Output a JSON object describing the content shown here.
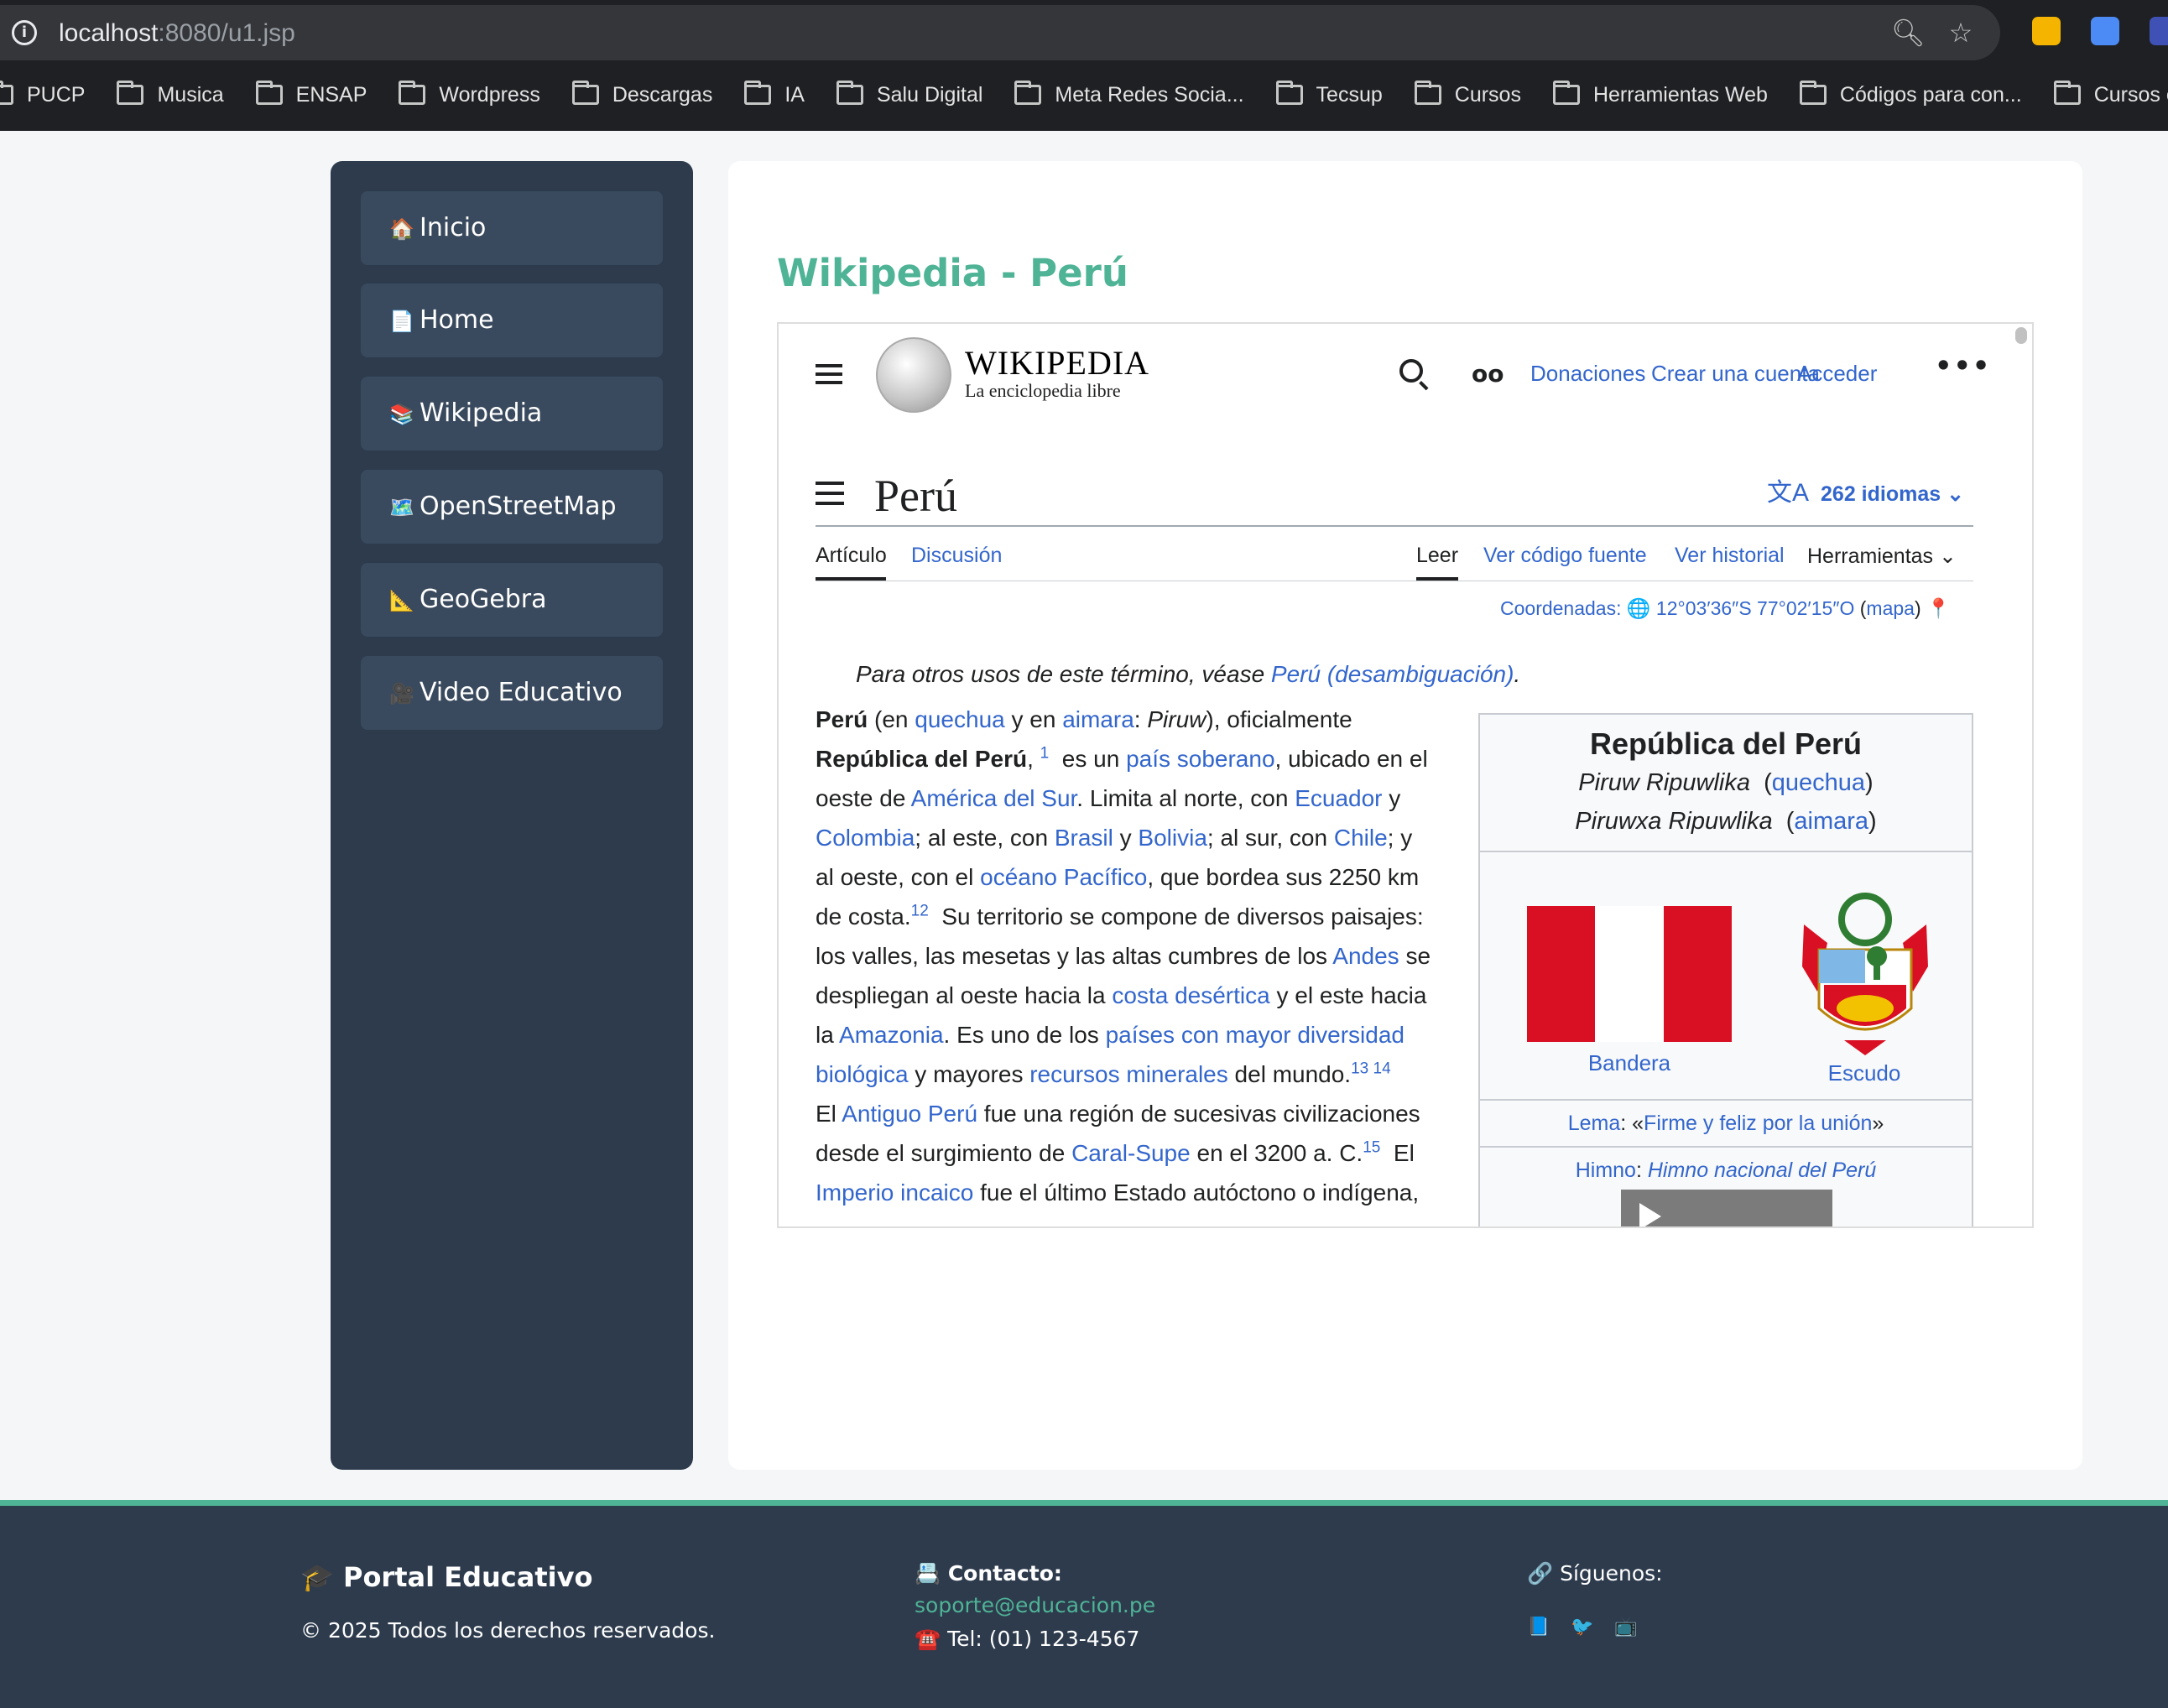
{
  "browser": {
    "url_host": "localhost",
    "url_path": ":8080/u1.jsp",
    "bookmarks": [
      "PUCP",
      "Musica",
      "ENSAP",
      "Wordpress",
      "Descargas",
      "IA",
      "Salu Digital",
      "Meta Redes Socia...",
      "Tecsup",
      "Cursos",
      "Herramientas Web",
      "Códigos para con...",
      "Cursos e"
    ]
  },
  "sidebar": {
    "items": [
      {
        "icon": "🏠",
        "label": "Inicio"
      },
      {
        "icon": "📄",
        "label": "Home"
      },
      {
        "icon": "📚",
        "label": "Wikipedia"
      },
      {
        "icon": "🗺️",
        "label": "OpenStreetMap"
      },
      {
        "icon": "📐",
        "label": "GeoGebra"
      },
      {
        "icon": "🎥",
        "label": "Video Educativo"
      }
    ]
  },
  "main": {
    "title": "Wikipedia - Perú"
  },
  "wiki": {
    "wordmark": "WIKIPEDIA",
    "tagline": "La enciclopedia libre",
    "header_links": [
      "Donaciones",
      "Crear una cuenta",
      "Acceder"
    ],
    "article_title": "Perú",
    "languages": "262 idiomas",
    "tabs_left": [
      "Artículo",
      "Discusión"
    ],
    "tabs_right": [
      "Leer",
      "Ver código fuente",
      "Ver historial",
      "Herramientas"
    ],
    "coords_label": "Coordenadas:",
    "coords_value": "12°03′36″S 77°02′15″O",
    "coords_map": "mapa",
    "hatnote_text": "Para otros usos de este término, véase ",
    "hatnote_link": "Perú (desambiguación)",
    "infobox": {
      "title": "República del Perú",
      "name_quechua": "Piruw Ripuwlika",
      "lang_quechua": "quechua",
      "name_aimara": "Piruwxa Ripuwlika",
      "lang_aimara": "aimara",
      "flag_caption": "Bandera",
      "coat_caption": "Escudo",
      "motto_label": "Lema",
      "motto": "Firme y feliz por la unión",
      "anthem_label": "Himno",
      "anthem": "Himno nacional del Perú"
    }
  },
  "footer": {
    "brand": "🎓 Portal Educativo",
    "copyright": "© 2025 Todos los derechos reservados.",
    "contact_title": "📇 Contacto:",
    "email": "soporte@educacion.pe",
    "phone": "☎️ Tel: (01) 123-4567",
    "follow": "🔗 Síguenos:",
    "social_icons": [
      "📘",
      "🐦",
      "📺"
    ]
  }
}
